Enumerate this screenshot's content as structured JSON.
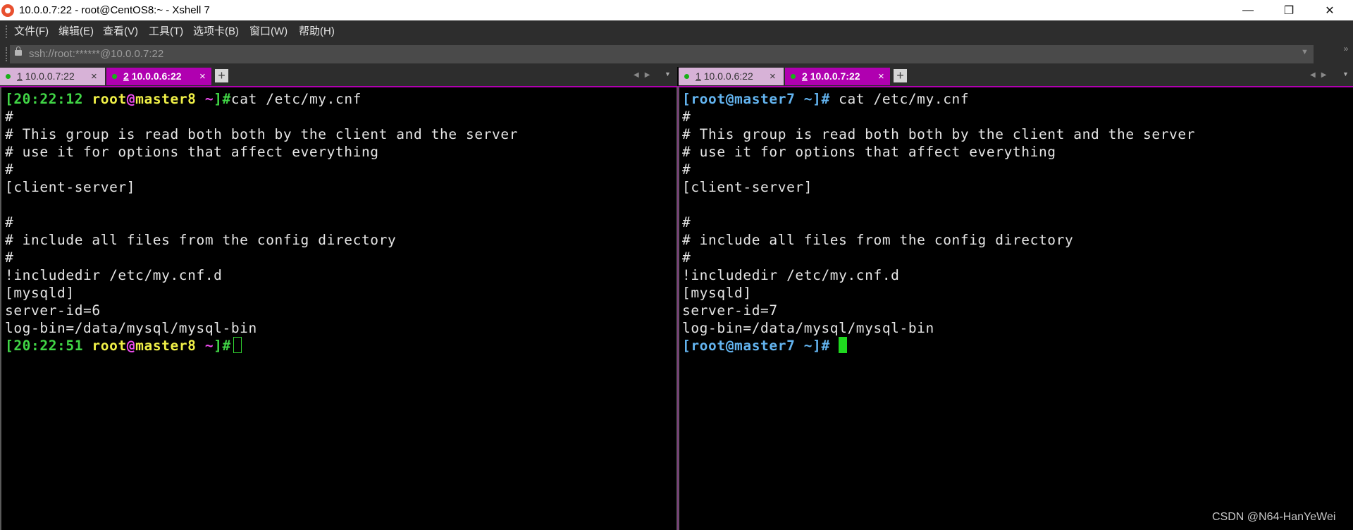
{
  "window": {
    "title": "10.0.0.7:22 - root@CentOS8:~ - Xshell 7",
    "minimize_symbol": "—",
    "maximize_symbol": "❐",
    "close_symbol": "✕"
  },
  "menu": {
    "items": [
      {
        "label": "文件(F)"
      },
      {
        "label": "编辑(E)"
      },
      {
        "label": "查看(V)"
      },
      {
        "label": "工具(T)"
      },
      {
        "label": "选项卡(B)"
      },
      {
        "label": "窗口(W)"
      },
      {
        "label": "帮助(H)"
      }
    ]
  },
  "address_bar": {
    "value": "ssh://root:******@10.0.0.7:22",
    "dropdown_symbol": "▼",
    "overflow_symbol": "»",
    "icon": "lock-icon"
  },
  "left": {
    "tabs": [
      {
        "number": "1",
        "label": "10.0.0.7:22",
        "close": "×",
        "active": false
      },
      {
        "number": "2",
        "label": "10.0.0.6:22",
        "close": "×",
        "active": true
      }
    ],
    "add_symbol": "+",
    "nav_symbols": "◀▶",
    "menu_symbol": "▼",
    "pane": {
      "lines": [
        "#",
        "# This group is read both both by the client and the server",
        "# use it for options that affect everything",
        "#",
        "[client-server]",
        "",
        "#",
        "# include all files from the config directory",
        "#",
        "!includedir /etc/my.cnf.d",
        "[mysqld]",
        "server-id=6",
        "log-bin=/data/mysql/mysql-bin"
      ],
      "prompt1": {
        "open": "[",
        "time": "20:22:12",
        "user": "root",
        "at": "@",
        "host": "master8",
        "path": "~",
        "close": "]#",
        "command": "cat /etc/my.cnf"
      },
      "prompt2": {
        "open": "[",
        "time": "20:22:51",
        "user": "root",
        "at": "@",
        "host": "master8",
        "path": "~",
        "close": "]#",
        "command": ""
      }
    }
  },
  "right": {
    "tabs": [
      {
        "number": "1",
        "label": "10.0.0.6:22",
        "close": "×",
        "active": false
      },
      {
        "number": "2",
        "label": "10.0.0.7:22",
        "close": "×",
        "active": true
      }
    ],
    "add_symbol": "+",
    "nav_symbols": "◀▶",
    "menu_symbol": "▼",
    "pane": {
      "lines": [
        "#",
        "# This group is read both both by the client and the server",
        "# use it for options that affect everything",
        "#",
        "[client-server]",
        "",
        "#",
        "# include all files from the config directory",
        "#",
        "!includedir /etc/my.cnf.d",
        "[mysqld]",
        "server-id=7",
        "log-bin=/data/mysql/mysql-bin"
      ],
      "prompt1": {
        "text": "[root@master7 ~]#",
        "command": "cat /etc/my.cnf"
      },
      "prompt2": {
        "text": "[root@master7 ~]#",
        "command": ""
      }
    }
  },
  "watermark": "CSDN @N64-HanYeWei",
  "colors": {
    "terminal_background": "#000000",
    "terminal_text": "#e5e5e5",
    "active_tab": "#b000b0",
    "inactive_tab": "#d7b2d7",
    "prompt_green": "#41d646",
    "prompt_yellow": "#f0f047",
    "prompt_magenta": "#ee4cee",
    "prompt_blue": "#63b4f0",
    "cursor_green": "#1fd81f"
  }
}
